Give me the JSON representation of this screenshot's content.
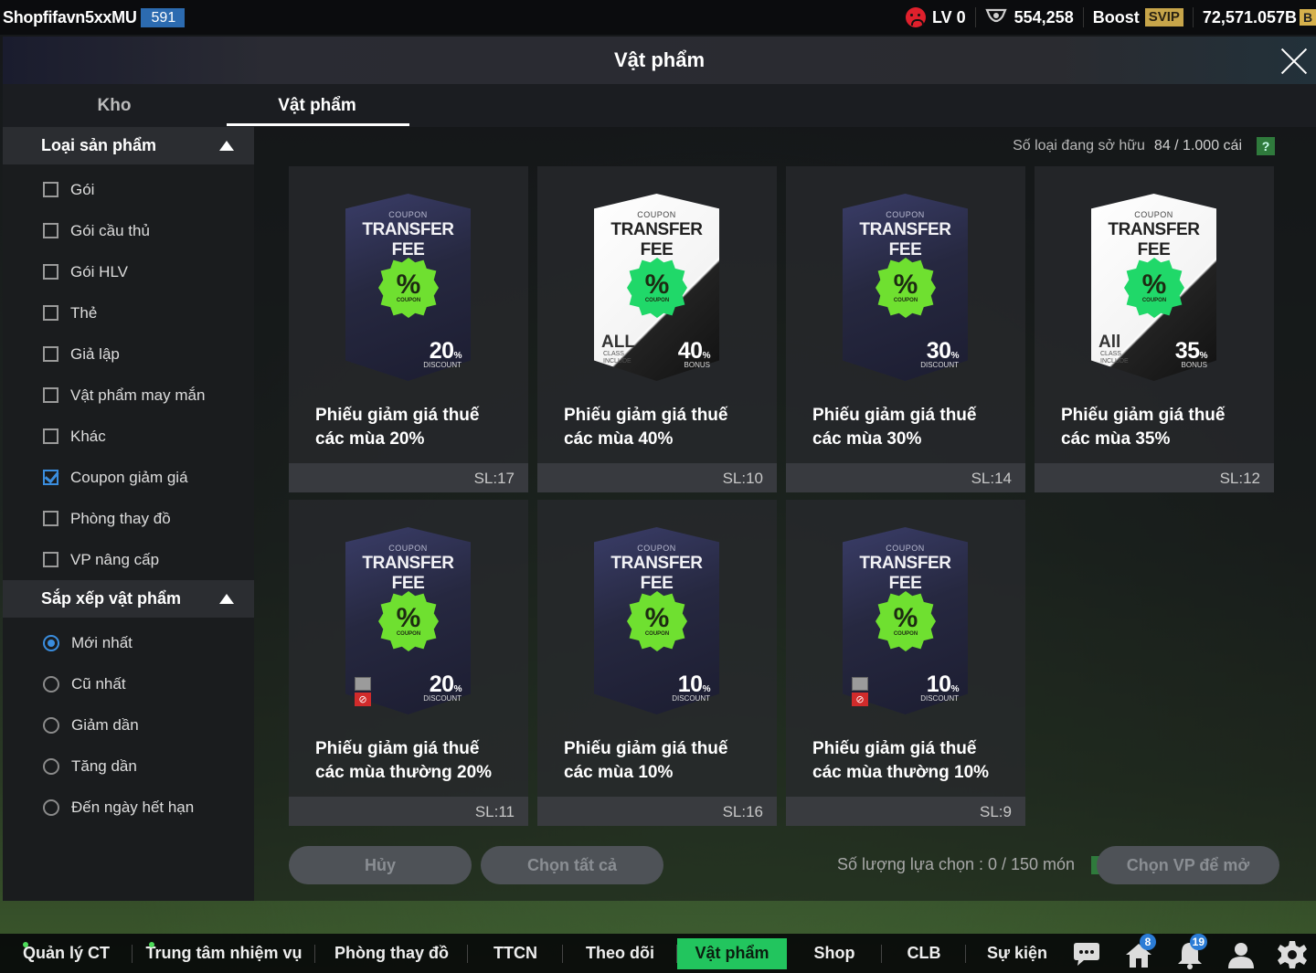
{
  "topbar": {
    "player_name": "Shopfifavn5xxMU",
    "player_level": "591",
    "lv": "LV 0",
    "trophies": "554,258",
    "boost": "Boost",
    "svip": "SVIP",
    "balance": "72,571.057B",
    "currency_icon": "B"
  },
  "modal": {
    "title": "Vật phẩm",
    "tabs": [
      "Kho",
      "Vật phẩm"
    ],
    "active_tab": "Vật phẩm"
  },
  "sidebar": {
    "filter_header": "Loại sản phẩm",
    "filters": [
      {
        "label": "Gói",
        "checked": false
      },
      {
        "label": "Gói cầu thủ",
        "checked": false
      },
      {
        "label": "Gói HLV",
        "checked": false
      },
      {
        "label": "Thẻ",
        "checked": false
      },
      {
        "label": "Giả lập",
        "checked": false
      },
      {
        "label": "Vật phẩm may mắn",
        "checked": false
      },
      {
        "label": "Khác",
        "checked": false
      },
      {
        "label": "Coupon giảm giá",
        "checked": true
      },
      {
        "label": "Phòng thay đồ",
        "checked": false
      },
      {
        "label": "VP nâng cấp",
        "checked": false
      }
    ],
    "sort_header": "Sắp xếp vật phẩm",
    "sorts": [
      {
        "label": "Mới nhất",
        "checked": true
      },
      {
        "label": "Cũ nhất",
        "checked": false
      },
      {
        "label": "Giảm dần",
        "checked": false
      },
      {
        "label": "Tăng dần",
        "checked": false
      },
      {
        "label": "Đến ngày hết hạn",
        "checked": false
      }
    ]
  },
  "content": {
    "owned_label": "Số loại đang sở hữu",
    "owned_count": "84 / 1.000 cái",
    "help": "?",
    "items": [
      {
        "title": "Phiếu giảm giá thuế các mùa 20%",
        "qty": "SL:17",
        "style": "dark",
        "value": "20",
        "sub": "DISCOUNT",
        "locked": false,
        "all": ""
      },
      {
        "title": "Phiếu giảm giá thuế các mùa 40%",
        "qty": "SL:10",
        "style": "white",
        "value": "40",
        "sub": "BONUS",
        "locked": false,
        "all": "ALL"
      },
      {
        "title": "Phiếu giảm giá thuế các mùa 30%",
        "qty": "SL:14",
        "style": "dark",
        "value": "30",
        "sub": "DISCOUNT",
        "locked": false,
        "all": ""
      },
      {
        "title": "Phiếu giảm giá thuế các mùa 35%",
        "qty": "SL:12",
        "style": "white",
        "value": "35",
        "sub": "BONUS",
        "locked": false,
        "all": "All"
      },
      {
        "title": "Phiếu giảm giá thuế các mùa thường 20%",
        "qty": "SL:11",
        "style": "dark",
        "value": "20",
        "sub": "DISCOUNT",
        "locked": true,
        "all": ""
      },
      {
        "title": "Phiếu giảm giá thuế các mùa 10%",
        "qty": "SL:16",
        "style": "dark",
        "value": "10",
        "sub": "DISCOUNT",
        "locked": false,
        "all": ""
      },
      {
        "title": "Phiếu giảm giá thuế các mùa thường 10%",
        "qty": "SL:9",
        "style": "dark",
        "value": "10",
        "sub": "DISCOUNT",
        "locked": true,
        "all": ""
      }
    ],
    "coupon_label": "COUPON",
    "fee_label": "TRANSFER FEE",
    "badge_pct": "%",
    "badge_label": "COUPON",
    "pct_small": "%",
    "class_label": "CLASS",
    "include_label": "INCLUDE"
  },
  "actions": {
    "cancel": "Hủy",
    "select_all": "Chọn tất cả",
    "selection_info": "Số lượng lựa chọn : 0 / 150 món",
    "open": "Chọn VP để mở"
  },
  "bottomnav": {
    "items": [
      "Quản lý CT",
      "Trung tâm nhiệm vụ",
      "Phòng thay đồ",
      "TTCN",
      "Theo dõi",
      "Vật phẩm",
      "Shop",
      "CLB",
      "Sự kiện"
    ],
    "active": "Vật phẩm",
    "notif_home": "8",
    "notif_bell": "19"
  },
  "colors": {
    "accent": "#22c55e",
    "checkbox": "#3a8dde",
    "coupon_badge_dark": "#6fe030",
    "coupon_badge_white": "#20d869"
  }
}
